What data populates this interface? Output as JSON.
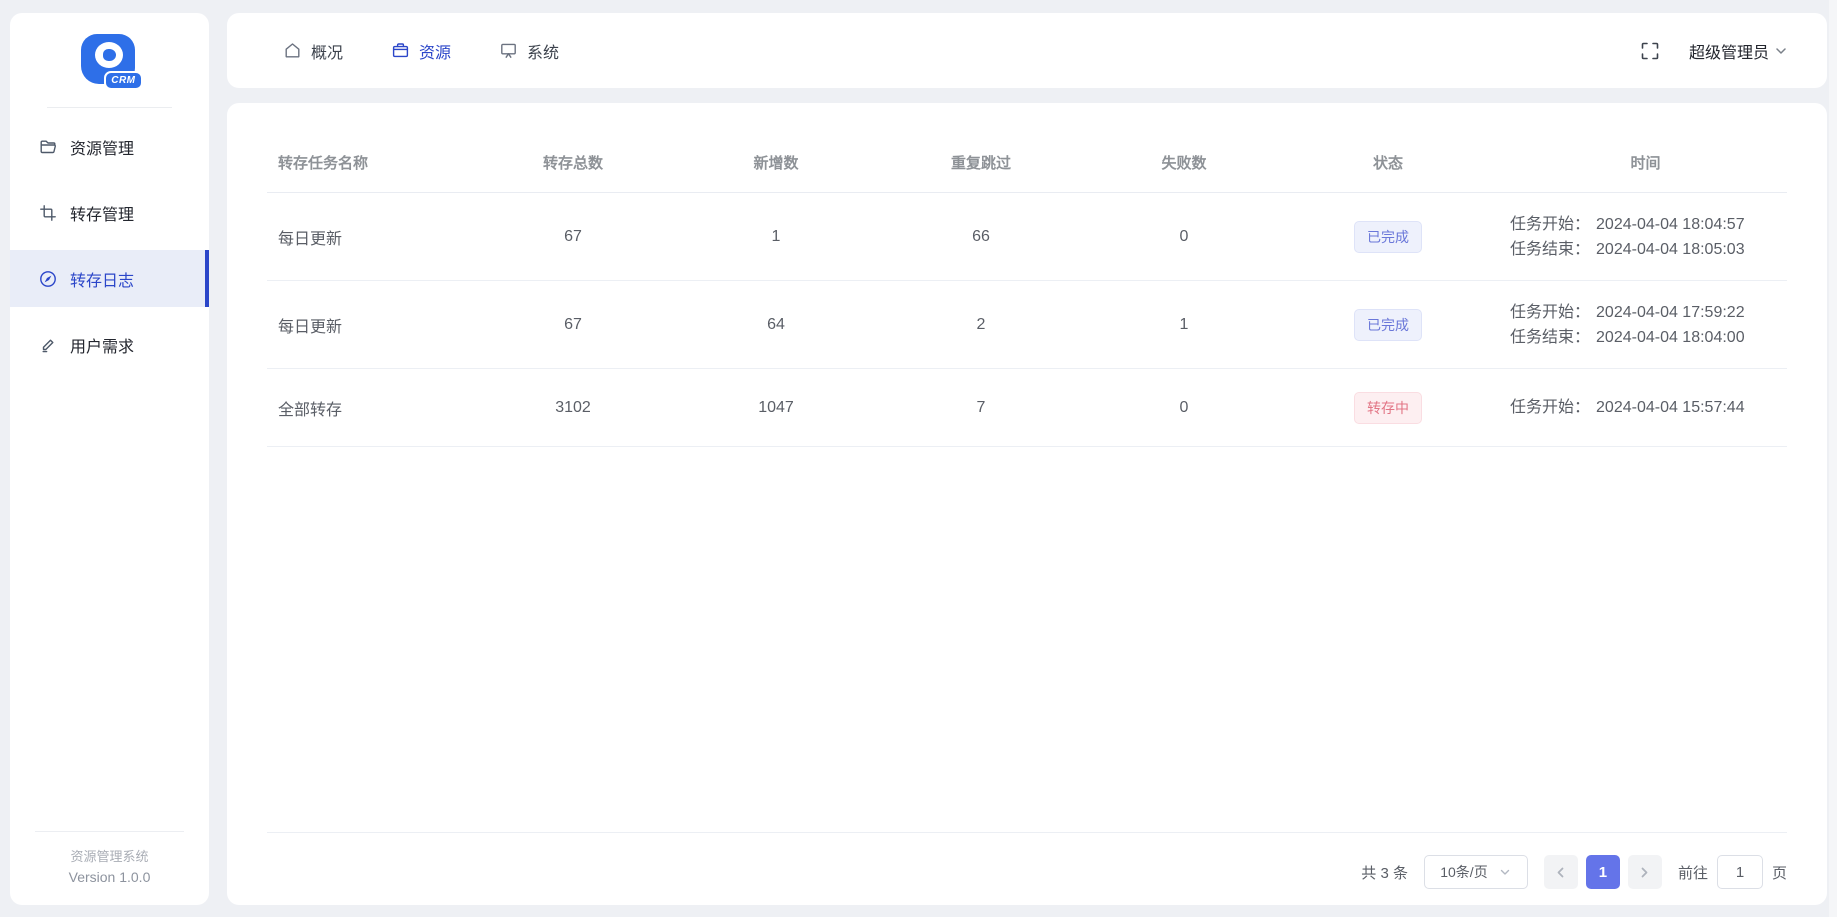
{
  "sidebar": {
    "logo_text": "CRM",
    "items": [
      {
        "label": "资源管理",
        "icon": "folder-icon"
      },
      {
        "label": "转存管理",
        "icon": "crop-icon"
      },
      {
        "label": "转存日志",
        "icon": "compass-icon",
        "active": true
      },
      {
        "label": "用户需求",
        "icon": "pencil-icon"
      }
    ],
    "footer": {
      "app_name": "资源管理系统",
      "version": "Version 1.0.0"
    }
  },
  "topbar": {
    "tabs": [
      {
        "label": "概况",
        "icon": "home-icon"
      },
      {
        "label": "资源",
        "icon": "briefcase-icon",
        "active": true
      },
      {
        "label": "系统",
        "icon": "presentation-icon"
      }
    ],
    "fullscreen_icon": "fullscreen-icon",
    "user_menu_label": "超级管理员"
  },
  "table": {
    "columns": [
      "转存任务名称",
      "转存总数",
      "新增数",
      "重复跳过",
      "失败数",
      "状态",
      "时间"
    ],
    "rows": [
      {
        "name": "每日更新",
        "total": "67",
        "added": "1",
        "skipped": "66",
        "failed": "0",
        "status": "已完成",
        "status_type": "success",
        "time_start_label": "任务开始：",
        "time_start": "2024-04-04 18:04:57",
        "time_end_label": "任务结束：",
        "time_end": "2024-04-04 18:05:03"
      },
      {
        "name": "每日更新",
        "total": "67",
        "added": "64",
        "skipped": "2",
        "failed": "1",
        "status": "已完成",
        "status_type": "success",
        "time_start_label": "任务开始：",
        "time_start": "2024-04-04 17:59:22",
        "time_end_label": "任务结束：",
        "time_end": "2024-04-04 18:04:00"
      },
      {
        "name": "全部转存",
        "total": "3102",
        "added": "1047",
        "skipped": "7",
        "failed": "0",
        "status": "转存中",
        "status_type": "danger",
        "time_start_label": "任务开始：",
        "time_start": "2024-04-04 15:57:44"
      }
    ]
  },
  "pagination": {
    "total_label": "共 3 条",
    "page_size": "10条/页",
    "current_page": "1",
    "goto_label": "前往",
    "goto_value": "1",
    "goto_suffix": "页"
  },
  "colors": {
    "page_background": "#eef0f4",
    "panel_background": "#ffffff",
    "primary_blue": "#2b46c9",
    "logo_blue": "#2e6fe8",
    "active_item_background": "#e9edf8",
    "badge_success_text": "#6a77d9",
    "badge_success_background": "#eef1fc",
    "badge_danger_text": "#e27585",
    "badge_danger_background": "#fdeff1",
    "pagination_active": "#6474e9",
    "table_header_text": "#8e9297",
    "cell_text": "#5a5e66"
  }
}
